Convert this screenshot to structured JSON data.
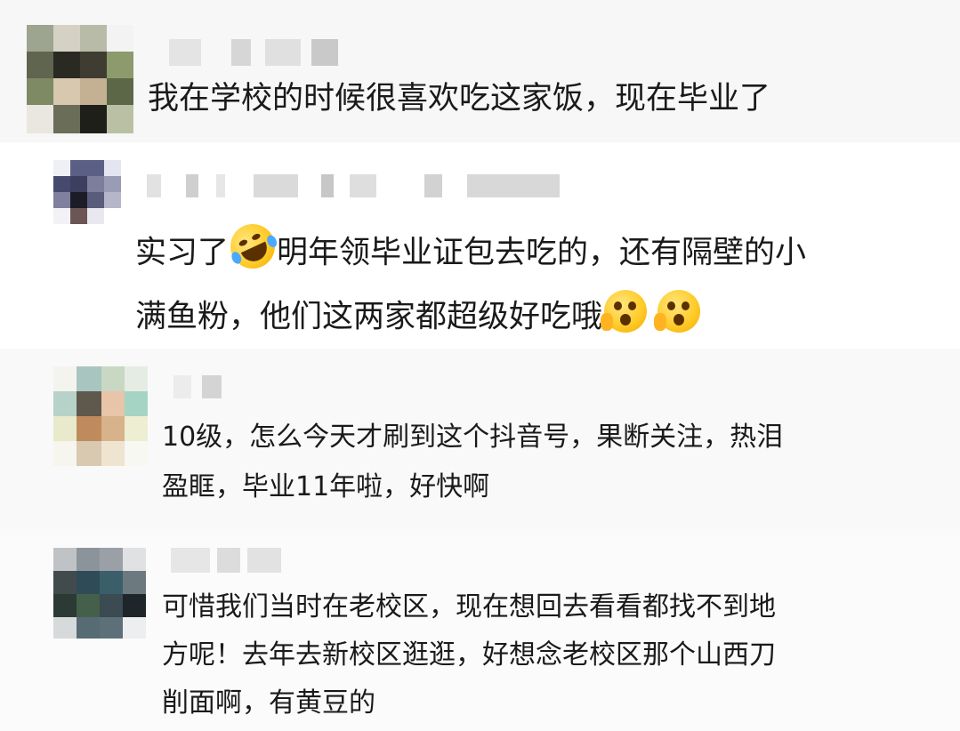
{
  "comments": [
    {
      "text_lines": [
        "我在学校的时候很喜欢吃这家饭，现在毕业了"
      ]
    },
    {
      "line1_pre": "实习了",
      "line1_emoji": "rofl-emoji",
      "line1_post": "明年领毕业证包去吃的，还有隔壁的小",
      "line2_pre": "满鱼粉，他们这两家都超级好吃哦",
      "line2_emojis": [
        "shocked-face-emoji",
        "shocked-face-emoji"
      ]
    },
    {
      "text_lines": [
        "10级，怎么今天才刷到这个抖音号，果断关注，热泪",
        "盈眶，毕业11年啦，好快啊"
      ]
    },
    {
      "text_lines": [
        "可惜我们当时在老校区，现在想回去看看都找不到地",
        "方呢！去年去新校区逛逛，好想念老校区那个山西刀",
        "削面啊，有黄豆的"
      ]
    }
  ],
  "colors": {
    "background": "#ffffff",
    "band": "#f6f6f6",
    "text": "#1a1a1a",
    "blur": "#d9d9d9"
  }
}
